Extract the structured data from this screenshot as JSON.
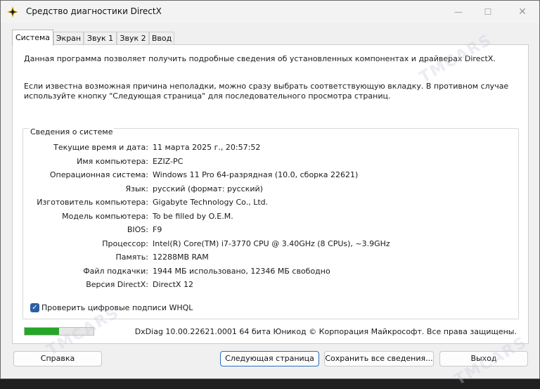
{
  "window": {
    "title": "Средство диагностики DirectX",
    "controls": {
      "minimize": "—",
      "maximize": "☐",
      "close": "✕"
    }
  },
  "tabs": [
    {
      "label": "Система",
      "active": true
    },
    {
      "label": "Экран",
      "active": false
    },
    {
      "label": "Звук 1",
      "active": false
    },
    {
      "label": "Звук 2",
      "active": false
    },
    {
      "label": "Ввод",
      "active": false
    }
  ],
  "intro": {
    "line1": "Данная программа позволяет получить подробные сведения об установленных компонентах и драйверах DirectX.",
    "line2": "Если известна возможная причина неполадки, можно сразу выбрать соответствующую вкладку. В противном случае используйте кнопку \"Следующая страница\" для последовательного просмотра страниц."
  },
  "system_info": {
    "title": "Сведения о системе",
    "rows": [
      {
        "label": "Текущие время и дата:",
        "value": "11 марта 2025 г., 20:57:52"
      },
      {
        "label": "Имя компьютера:",
        "value": "EZIZ-PC"
      },
      {
        "label": "Операционная система:",
        "value": "Windows 11 Pro 64-разрядная (10.0, сборка 22621)"
      },
      {
        "label": "Язык:",
        "value": "русский (формат: русский)"
      },
      {
        "label": "Изготовитель компьютера:",
        "value": "Gigabyte Technology Co., Ltd."
      },
      {
        "label": "Модель компьютера:",
        "value": "To be filled by O.E.M."
      },
      {
        "label": "BIOS:",
        "value": "F9"
      },
      {
        "label": "Процессор:",
        "value": "Intel(R) Core(TM) i7-3770 CPU @ 3.40GHz (8 CPUs), ~3.9GHz"
      },
      {
        "label": "Память:",
        "value": "12288MB RAM"
      },
      {
        "label": "Файл подкачки:",
        "value": "1944 МБ использовано, 12346 МБ свободно"
      },
      {
        "label": "Версия DirectX:",
        "value": "DirectX 12"
      }
    ]
  },
  "whql_check": {
    "label": "Проверить цифровые подписи WHQL",
    "checked": true
  },
  "progress": {
    "fraction": 0.5,
    "color": "#26a626"
  },
  "footer": "DxDiag 10.00.22621.0001 64 бита Юникод © Корпорация Майкрософт. Все права защищены.",
  "buttons": {
    "help": "Справка",
    "next_page": "Следующая страница",
    "save_all": "Сохранить все сведения...",
    "exit": "Выход"
  },
  "watermark": "TMCARS",
  "colors": {
    "accent": "#2d6fc0",
    "checkbox": "#2b5fa6"
  }
}
